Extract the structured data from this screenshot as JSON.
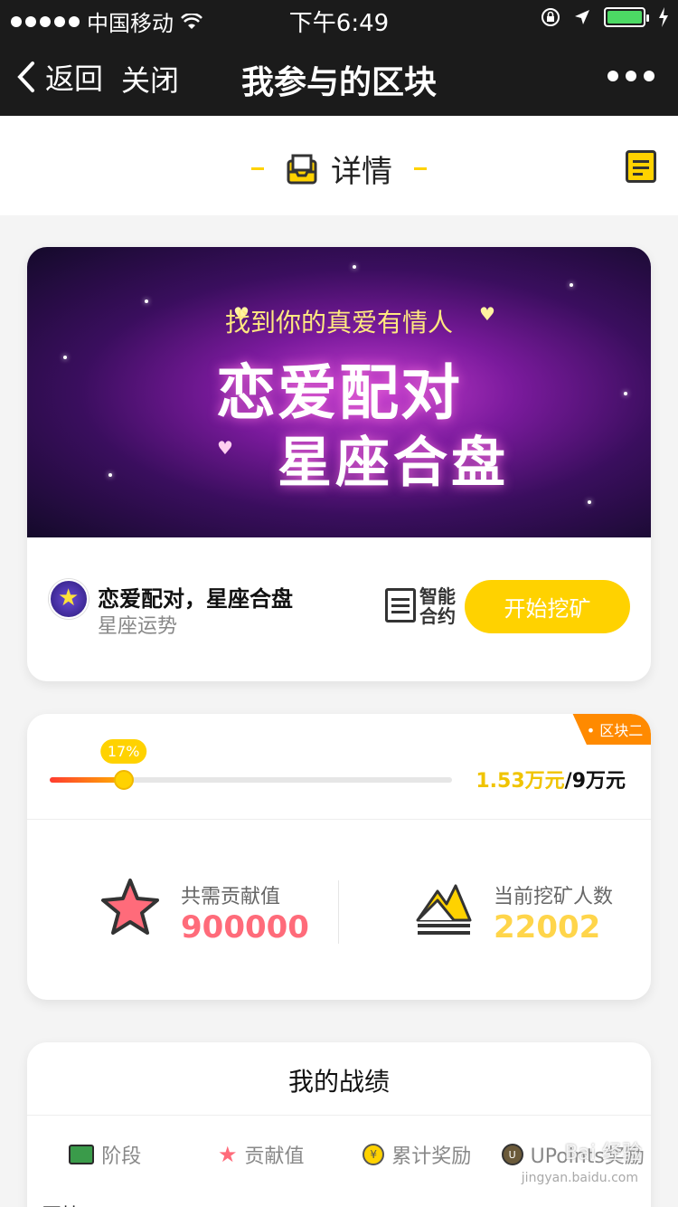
{
  "status_bar": {
    "carrier": "中国移动",
    "time": "下午6:49"
  },
  "nav": {
    "back_label": "返回",
    "close_label": "关闭",
    "title": "我参与的区块"
  },
  "detail_header": {
    "title": "详情"
  },
  "banner": {
    "subtitle": "找到你的真爱有情人",
    "main_line1": "恋爱配对",
    "main_line2": "星座合盘"
  },
  "project": {
    "name": "恋爱配对，星座合盘",
    "category": "星座运势",
    "contract_line1": "智能",
    "contract_line2": "合约",
    "start_button": "开始挖矿"
  },
  "block": {
    "badge": "• 区块二",
    "progress_percent": 17,
    "progress_label": "17%",
    "amount_current": "1.53万元",
    "amount_total": "/9万元",
    "required_label": "共需贡献值",
    "required_value": "900000",
    "miners_label": "当前挖矿人数",
    "miners_value": "22002"
  },
  "record": {
    "title": "我的战绩",
    "columns": [
      "阶段",
      "贡献值",
      "累计奖励",
      "UPoints奖励"
    ],
    "first_row_partial": "区块"
  },
  "watermark": {
    "text": "Bai 经验",
    "sub": "jingyan.baidu.com"
  },
  "colors": {
    "accent": "#ffd200",
    "nav_bg": "#1b1b1b",
    "badge": "#ff8a00",
    "pink_value": "#ff6b7a"
  }
}
